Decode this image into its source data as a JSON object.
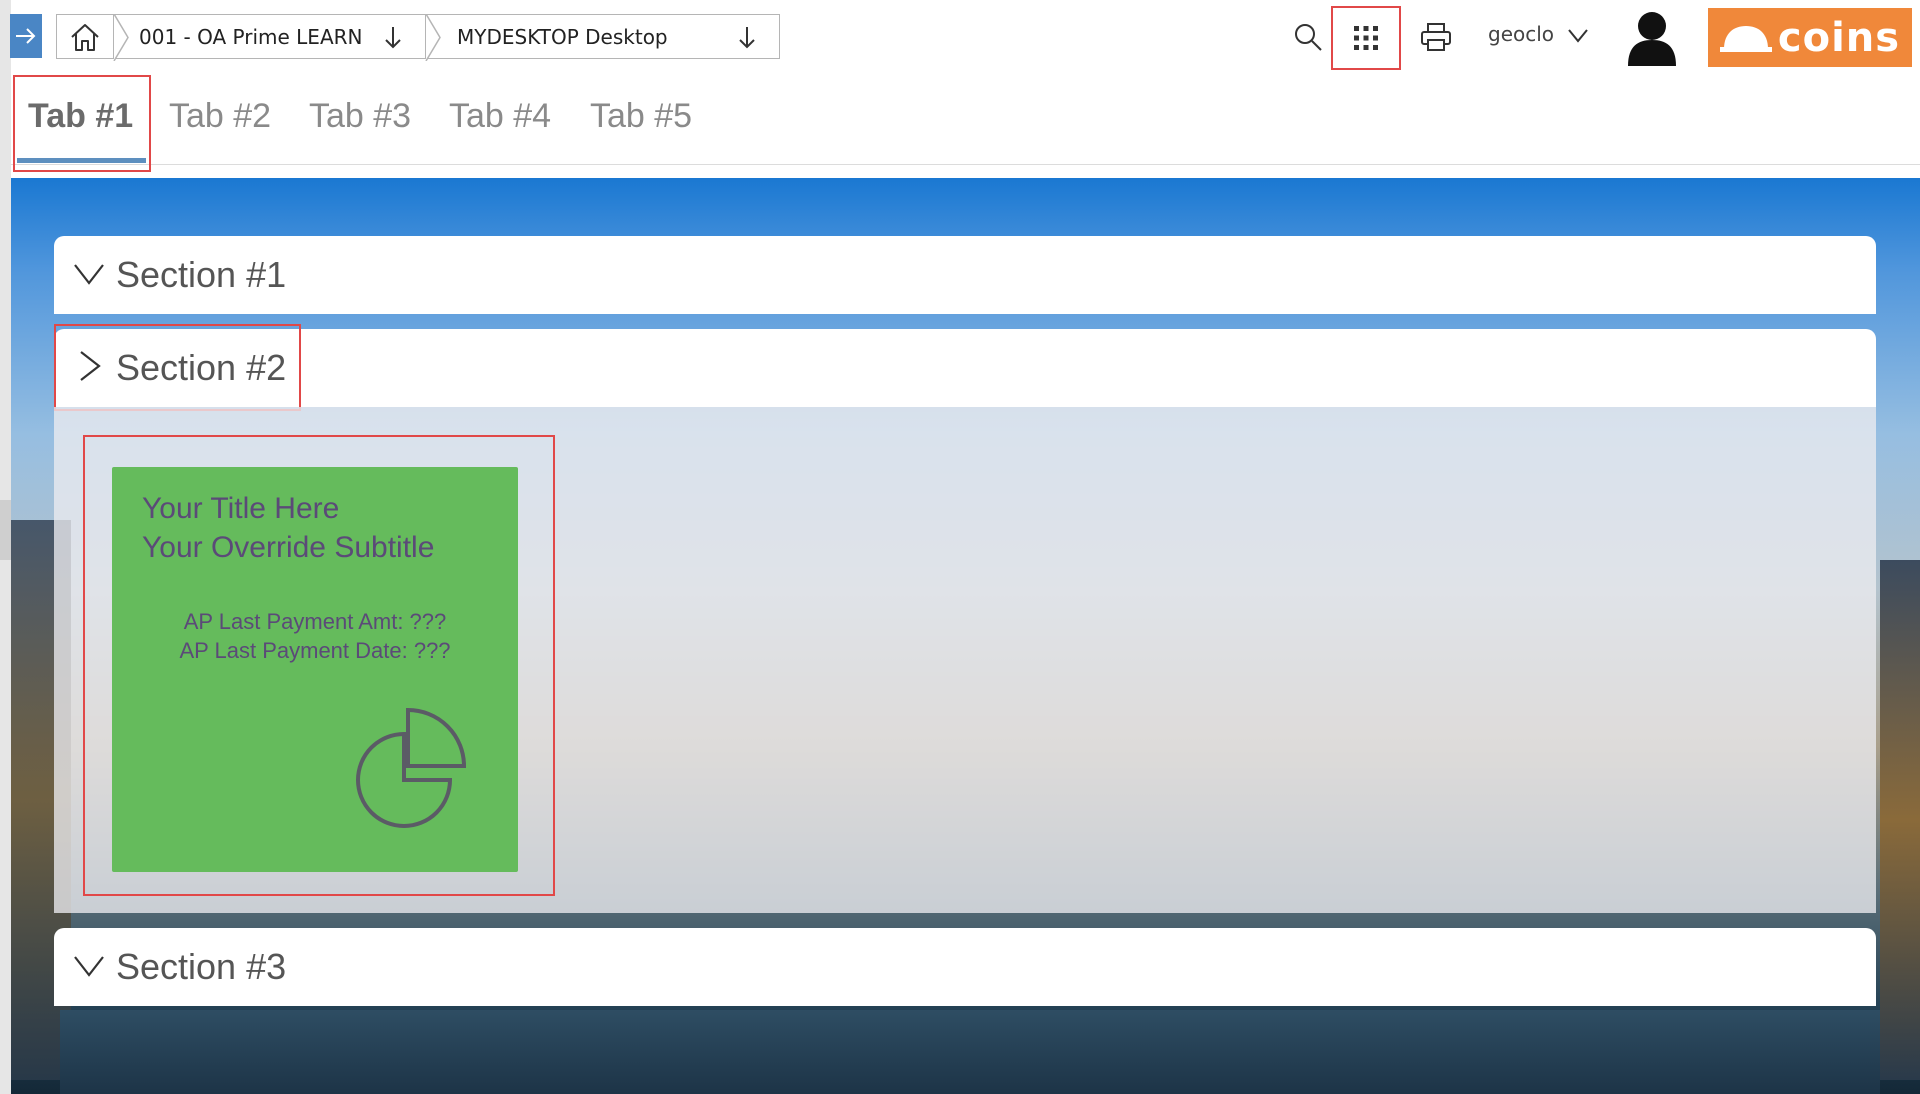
{
  "header": {
    "breadcrumb": [
      {
        "label": "001 - OA Prime LEARN"
      },
      {
        "label": "MYDESKTOP Desktop"
      }
    ],
    "user_name": "geoclo",
    "logo_text": "coins"
  },
  "tabs": [
    {
      "label": "Tab #1",
      "active": true
    },
    {
      "label": "Tab #2"
    },
    {
      "label": "Tab #3"
    },
    {
      "label": "Tab #4"
    },
    {
      "label": "Tab #5"
    }
  ],
  "sections": [
    {
      "title": "Section #1",
      "state": "collapsed"
    },
    {
      "title": "Section #2",
      "state": "expanded"
    },
    {
      "title": "Section #3",
      "state": "collapsed"
    }
  ],
  "tile": {
    "title": "Your Title Here",
    "subtitle": "Your Override Subtitle",
    "line1": "AP Last Payment Amt: ???",
    "line2": "AP Last Payment Date: ???",
    "icon": "pie-chart-icon"
  },
  "colors": {
    "accent": "#4a86c5",
    "logo": "#f0883a",
    "tile": "#65bb5c",
    "highlight": "#e14848"
  }
}
